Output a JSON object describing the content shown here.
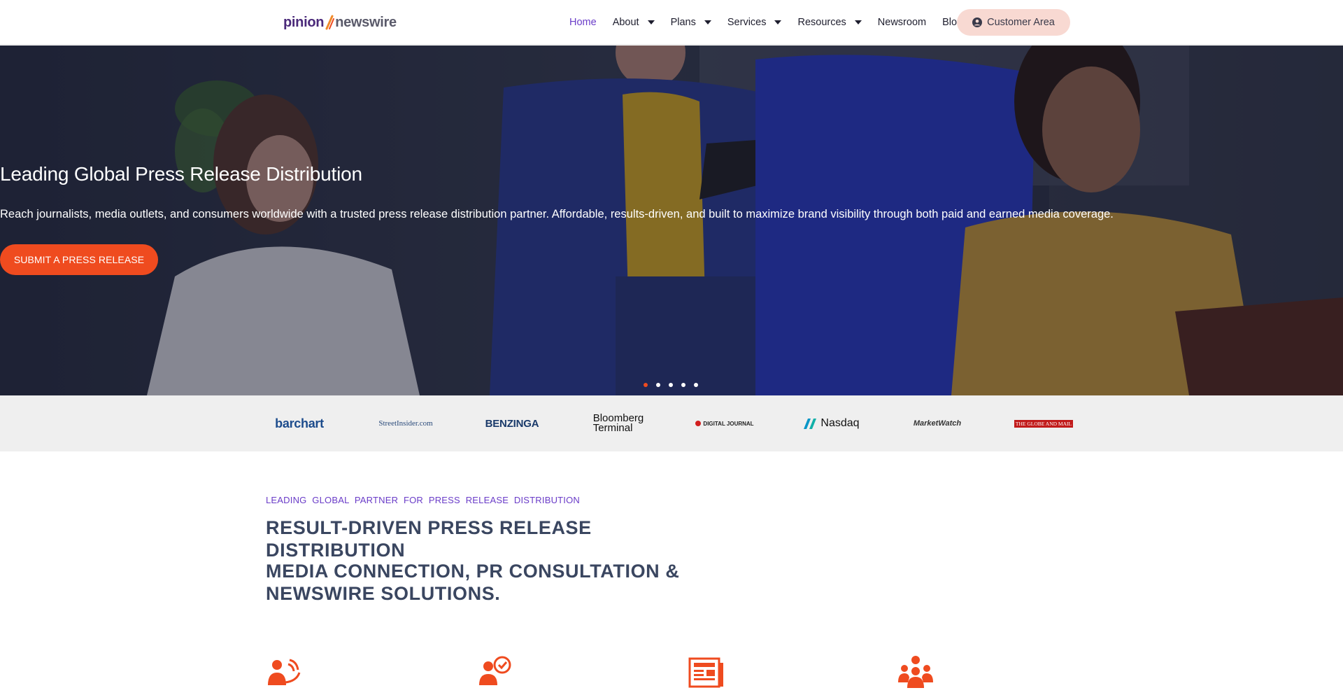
{
  "brand": {
    "logo_part1": "pinion",
    "logo_part2": "newswire",
    "accent": "#ef4b1f",
    "purple": "#6a3cc8"
  },
  "nav": {
    "items": [
      {
        "label": "Home",
        "active": true
      },
      {
        "label": "About",
        "dropdown": true
      },
      {
        "label": "Plans",
        "dropdown": true
      },
      {
        "label": "Services",
        "dropdown": true
      },
      {
        "label": "Resources",
        "dropdown": true
      },
      {
        "label": "Newsroom"
      },
      {
        "label": "Blog"
      }
    ],
    "customer_area": "Customer Area",
    "customer_icon": "user-circle-icon"
  },
  "hero": {
    "title": "Leading Global Press Release Distribution",
    "subtitle": "Reach journalists, media outlets, and consumers worldwide with a trusted press release distribution partner. Affordable, results-driven, and built to maximize brand visibility through both paid and earned media coverage.",
    "cta": "SUBMIT A PRESS RELEASE",
    "slides": 5,
    "active_slide": 1
  },
  "media_logos": {
    "barchart": "barchart",
    "streetinsider": "StreetInsider.com",
    "benzinga": "BENZINGA",
    "bloomberg_1": "Bloomberg",
    "bloomberg_2": "Terminal",
    "digitaljournal": "DIGITAL JOURNAL",
    "nasdaq": "Nasdaq",
    "marketwatch": "MarketWatch",
    "globeandmail": "THE GLOBE AND MAIL"
  },
  "section": {
    "eyebrow": "LEADING GLOBAL PARTNER FOR PRESS RELEASE DISTRIBUTION",
    "headline": "RESULT-DRIVEN PRESS RELEASE DISTRIBUTION",
    "headline2": "MEDIA CONNECTION, PR CONSULTATION & NEWSWIRE SOLUTIONS."
  },
  "feature_icons": [
    "broadcast-person-icon",
    "verified-person-icon",
    "newspaper-icon",
    "team-icon"
  ]
}
